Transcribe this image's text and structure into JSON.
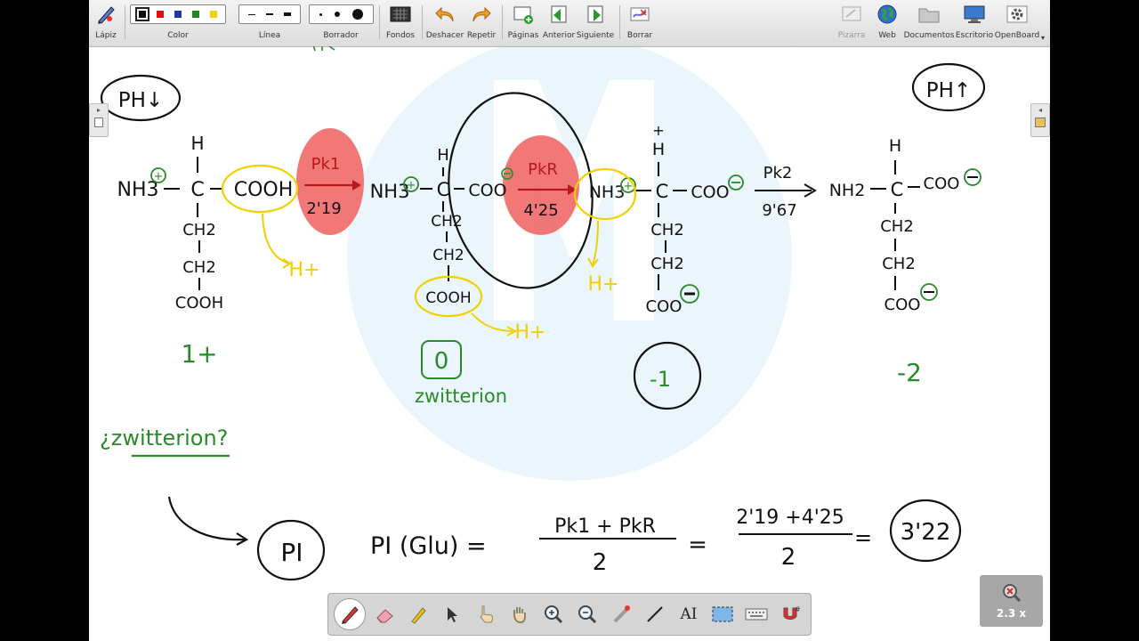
{
  "toolbar": {
    "pen_label": "Lápiz",
    "color_label": "Color",
    "line_label": "Línea",
    "eraser_label": "Borrador",
    "backgrounds_label": "Fondos",
    "undo_label": "Deshacer",
    "redo_label": "Repetir",
    "pages_label": "Páginas",
    "previous_label": "Anterior",
    "next_label": "Siguiente",
    "clear_label": "Borrar",
    "board_label": "Pizarra",
    "web_label": "Web",
    "documents_label": "Documentos",
    "desktop_label": "Escritorio",
    "openboard_label": "OpenBoard",
    "colors": [
      "#111111",
      "#e01010",
      "#1a3aa8",
      "#1a8a1a",
      "#f0d000"
    ]
  },
  "board": {
    "ph_low": "PH↓",
    "ph_high": "PH↑",
    "m1": {
      "top": "H",
      "left": "NH3",
      "group": "COOH",
      "ch2a": "CH2",
      "ch2b": "CH2",
      "bottom": "COOH"
    },
    "arrow1": {
      "top": "Pk1",
      "bottom": "2'19"
    },
    "m2": {
      "top": "H",
      "left": "NH3",
      "group": "COO",
      "ch2a": "CH2",
      "ch2b": "CH2",
      "bottom": "COOH"
    },
    "arrow2": {
      "top": "PkR",
      "bottom": "4'25"
    },
    "m3": {
      "top": "H",
      "left": "NH3",
      "group": "COO",
      "ch2a": "CH2",
      "ch2b": "CH2",
      "bottom": "COO"
    },
    "arrow3": {
      "top": "Pk2",
      "bottom": "9'67"
    },
    "m4": {
      "top": "H",
      "left": "NH2",
      "group": "COO",
      "ch2a": "CH2",
      "ch2b": "CH2",
      "bottom": "COO"
    },
    "hplus": "H+",
    "charge1": "1+",
    "charge2": "0",
    "zwitterion": "zwitterion",
    "charge3": "-1",
    "charge4": "-2",
    "question": "¿zwitterion?",
    "pi_box": "PI",
    "formula_left": "PI (Glu) =",
    "frac1_num": "Pk1 + PkR",
    "frac1_den": "2",
    "equals2": "=",
    "frac2_num": "2'19 +4'25",
    "frac2_den": "2",
    "equals3": "=",
    "result": "3'22"
  },
  "zoom": {
    "label": "2.3 x"
  }
}
